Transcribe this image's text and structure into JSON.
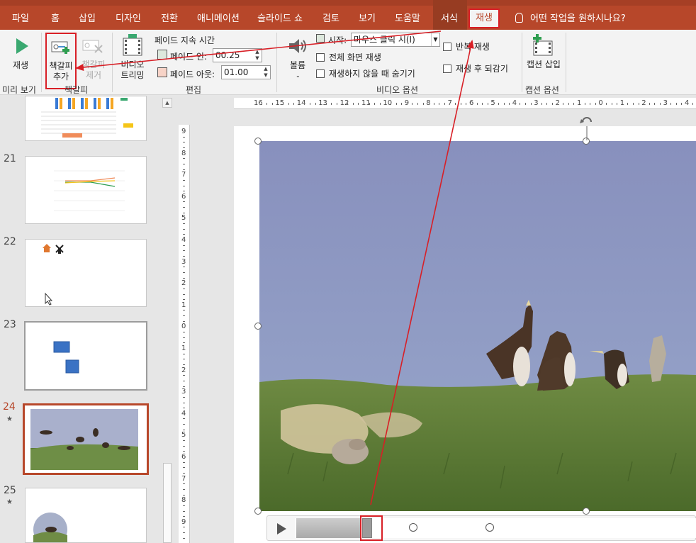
{
  "menu": {
    "tabs": [
      "파일",
      "홈",
      "삽입",
      "디자인",
      "전환",
      "애니메이션",
      "슬라이드 쇼",
      "검토",
      "보기",
      "도움말",
      "서식"
    ],
    "active_tab": "재생",
    "tell_me": "어떤 작업을 원하시나요?"
  },
  "ribbon": {
    "preview": {
      "play_label": "재생",
      "group_label": "미리 보기"
    },
    "bookmark": {
      "add_label": "책갈피 추가",
      "remove_label": "책갈피 제거",
      "group_label": "책갈피"
    },
    "editing": {
      "trim_label": "비디오 트리밍",
      "fade_duration_label": "페이드 지속 시간",
      "fade_in_label": "페이드 인:",
      "fade_in_value": "00.25",
      "fade_out_label": "페이드 아웃:",
      "fade_out_value": "01.00",
      "group_label": "편집"
    },
    "video_options": {
      "volume_label": "볼륨",
      "start_label": "시작:",
      "start_value": "마우스 클릭 시(I)",
      "fullscreen_label": "전체 화면 재생",
      "hide_label": "재생하지 않을 때 숨기기",
      "loop_label": "반복 재생",
      "rewind_label": "재생 후 되감기",
      "group_label": "비디오 옵션"
    },
    "captions": {
      "insert_label": "캡션 삽입",
      "group_label": "캡션 옵션"
    }
  },
  "slides": [
    {
      "number": "21",
      "starred": false
    },
    {
      "number": "22",
      "starred": false
    },
    {
      "number": "23",
      "starred": false
    },
    {
      "number": "24",
      "starred": true,
      "selected": true
    },
    {
      "number": "25",
      "starred": true
    }
  ],
  "ruler": {
    "horizontal": [
      "16",
      "15",
      "14",
      "13",
      "12",
      "11",
      "10",
      "9",
      "8",
      "7",
      "6",
      "5",
      "4",
      "3",
      "2",
      "1",
      "0",
      "1",
      "2",
      "3",
      "4"
    ],
    "vertical": [
      "9",
      "8",
      "7",
      "6",
      "5",
      "4",
      "3",
      "2",
      "1",
      "0",
      "1",
      "2",
      "3",
      "4",
      "5",
      "6",
      "7",
      "8",
      "9"
    ]
  },
  "player": {
    "progress_fraction": 0.16,
    "bookmark_count": 2
  },
  "colors": {
    "accent": "#b7472a",
    "highlight": "#d81f26",
    "selected_slide_border": "#b7472a"
  }
}
